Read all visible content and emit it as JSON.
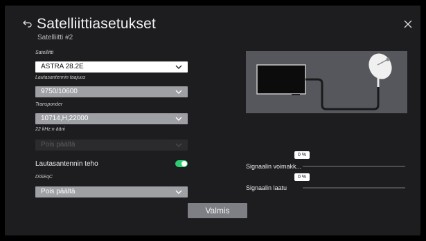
{
  "header": {
    "title": "Satelliittiasetukset",
    "subtitle": "Satelliitti #2",
    "back_icon": "back-arrow-icon",
    "close_icon": "close-icon"
  },
  "fields": {
    "satellite": {
      "label": "Satelliitti",
      "value": "ASTRA 28.2E"
    },
    "lnb_freq": {
      "label": "Lautasantennin taajuus",
      "value": "9750/10600"
    },
    "transponder": {
      "label": "Transponder",
      "value": "10714,H,22000"
    },
    "tone_22khz": {
      "label": "22 kHz:n ääni",
      "value": "Pois päältä",
      "disabled": true
    },
    "lnb_power": {
      "label": "Lautasantennin teho",
      "on": true
    },
    "diseqc": {
      "label": "DiSEqC",
      "value": "Pois päältä"
    }
  },
  "signal": {
    "strength": {
      "label": "Signaalin voimakk...",
      "percent_text": "0 %",
      "value": 0
    },
    "quality": {
      "label": "Signaalin laatu",
      "percent_text": "0 %",
      "value": 0
    }
  },
  "done_button": {
    "label": "Valmis"
  },
  "colors": {
    "dialog_bg": "#1d1d1f",
    "select_active": "#ffffff",
    "select_grey": "#9ea0a4",
    "toggle_on": "#2ecc71",
    "button": "#7d7f84"
  }
}
